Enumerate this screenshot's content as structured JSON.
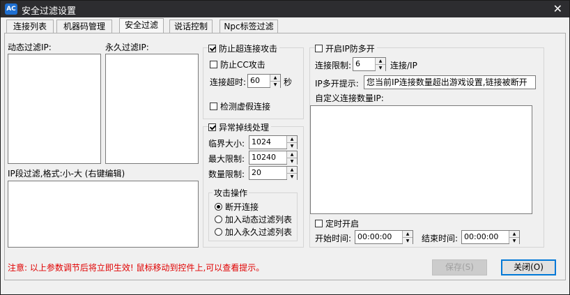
{
  "window": {
    "title": "安全过滤设置",
    "icon_text": "AC",
    "close_glyph": "✕"
  },
  "tabs": [
    {
      "label": "连接列表"
    },
    {
      "label": "机器码管理"
    },
    {
      "label": "安全过滤",
      "active": true
    },
    {
      "label": "说话控制"
    },
    {
      "label": "Npc标签过滤"
    }
  ],
  "left": {
    "dynamic_filter_label": "动态过滤IP:",
    "permanent_filter_label": "永久过滤IP:",
    "ip_range_label": "IP段过滤,格式:小-大 (右键编辑)"
  },
  "anti_flood": {
    "title": "防止超连接攻击",
    "checked": true,
    "anti_cc_label": "防止CC攻击",
    "anti_cc_checked": false,
    "timeout_label": "连接超时:",
    "timeout_value": "60",
    "timeout_unit": "秒",
    "detect_fake_label": "检测虚假连接",
    "detect_fake_checked": false
  },
  "abnormal": {
    "title": "异常掉线处理",
    "checked": true,
    "critical_label": "临界大小:",
    "critical_value": "1024",
    "max_label": "最大限制:",
    "max_value": "10240",
    "count_label": "数量限制:",
    "count_value": "20",
    "attack_group_title": "攻击操作",
    "options": [
      {
        "label": "断开连接",
        "checked": true
      },
      {
        "label": "加入动态过滤列表",
        "checked": false
      },
      {
        "label": "加入永久过滤列表",
        "checked": false
      }
    ]
  },
  "multi_ip": {
    "title": "开启IP防多开",
    "checked": false,
    "limit_label": "连接限制:",
    "limit_value": "6",
    "limit_unit": "连接/IP",
    "hint_label": "IP多开提示:",
    "hint_value": "您当前IP连接数量超出游戏设置,链接被断开",
    "custom_label": "自定义连接数量IP:",
    "timed_label": "定时开启",
    "timed_checked": false,
    "start_label": "开始时间:",
    "start_value": "00:00:00",
    "end_label": "结束时间:",
    "end_value": "00:00:00"
  },
  "footer": {
    "notice": "注意: 以上参数调节后将立即生效! 鼠标移动到控件上,可以查看提示。",
    "save_label": "保存(S)",
    "close_label": "关闭(O)"
  },
  "colors": {
    "notice": "#e00000",
    "titlebar": "#2d2d30",
    "accent": "#0078d7"
  }
}
